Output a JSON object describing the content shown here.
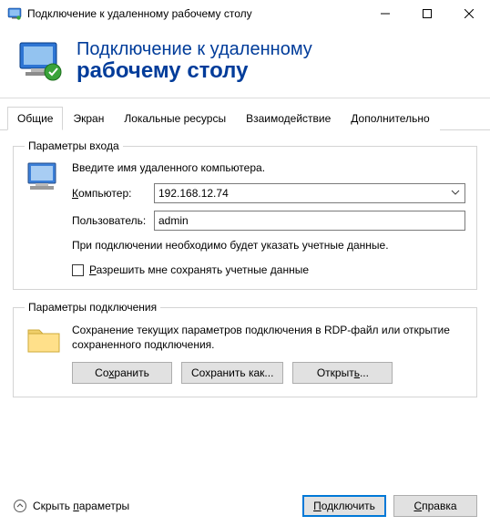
{
  "window": {
    "title": "Подключение к удаленному рабочему столу"
  },
  "header": {
    "line1": "Подключение к удаленному",
    "line2": "рабочему столу"
  },
  "tabs": {
    "general": "Общие",
    "display": "Экран",
    "localres": "Локальные ресурсы",
    "experience": "Взаимодействие",
    "advanced": "Дополнительно"
  },
  "login_group": {
    "legend": "Параметры входа",
    "prompt": "Введите имя удаленного компьютера.",
    "computer_label": "Компьютер:",
    "computer_value": "192.168.12.74",
    "user_label": "Пользователь:",
    "user_value": "admin",
    "info": "При подключении необходимо будет указать учетные данные.",
    "save_creds": "Разрешить мне сохранять учетные данные"
  },
  "conn_group": {
    "legend": "Параметры подключения",
    "desc": "Сохранение текущих параметров подключения в RDP-файл или открытие сохраненного подключения.",
    "save": "Сохранить",
    "save_as": "Сохранить как...",
    "open": "Открыть..."
  },
  "footer": {
    "collapse": "Скрыть параметры",
    "connect": "Подключить",
    "help": "Справка"
  }
}
